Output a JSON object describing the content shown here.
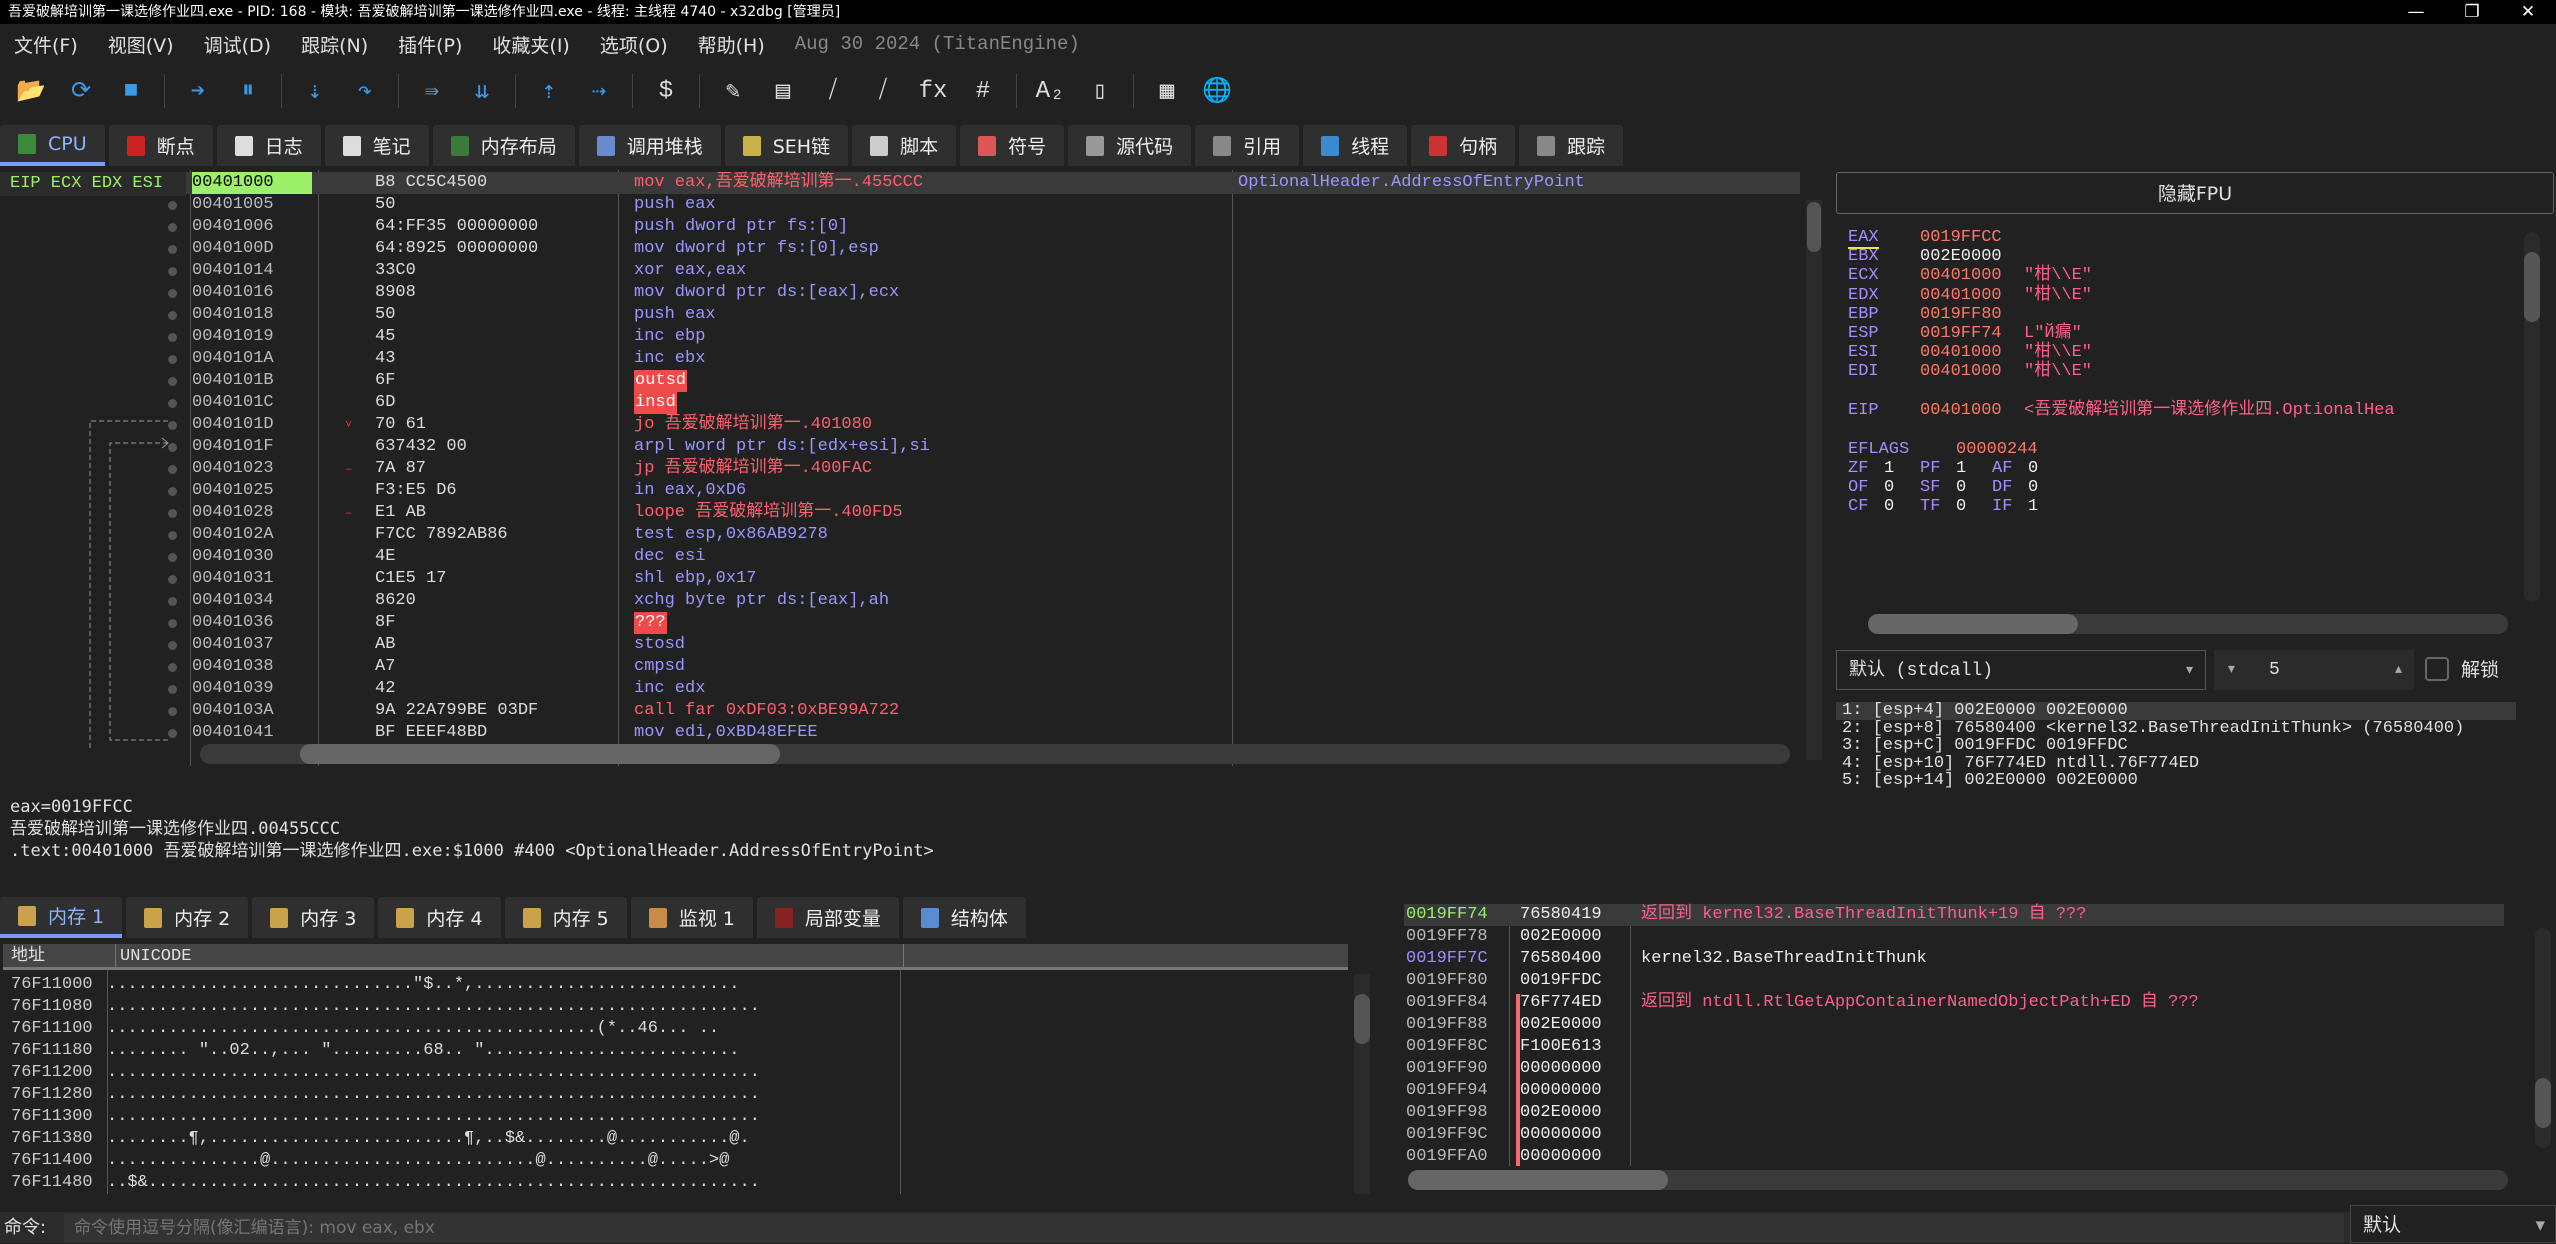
{
  "window": {
    "title": "吾爱破解培训第一课选修作业四.exe - PID: 168 - 模块: 吾爱破解培训第一课选修作业四.exe - 线程: 主线程 4740 - x32dbg [管理员]",
    "controls": [
      "—",
      "❐",
      "✕"
    ]
  },
  "menu": {
    "items": [
      "文件(F)",
      "视图(V)",
      "调试(D)",
      "跟踪(N)",
      "插件(P)",
      "收藏夹(I)",
      "选项(O)",
      "帮助(H)"
    ],
    "version": "Aug 30 2024 (TitanEngine)"
  },
  "toolbar": [
    {
      "icon": "open-folder-icon",
      "g": "📂"
    },
    {
      "icon": "restart-icon",
      "g": "⟳"
    },
    {
      "icon": "stop-icon",
      "g": "■"
    },
    {
      "sep": true
    },
    {
      "icon": "run-icon",
      "g": "➔"
    },
    {
      "icon": "pause-icon",
      "g": "⏸"
    },
    {
      "sep": true
    },
    {
      "icon": "step-into-icon",
      "g": "⇣"
    },
    {
      "icon": "step-over-icon",
      "g": "↷"
    },
    {
      "sep": true
    },
    {
      "icon": "trace-into-icon",
      "g": "⇛"
    },
    {
      "icon": "trace-over-icon",
      "g": "⇊"
    },
    {
      "sep": true
    },
    {
      "icon": "execute-till-return-icon",
      "g": "⇡"
    },
    {
      "icon": "run-to-user-code-icon",
      "g": "⇢"
    },
    {
      "sep": true
    },
    {
      "icon": "script-icon",
      "g": "$"
    },
    {
      "sep": true
    },
    {
      "icon": "patch-icon",
      "g": "✎"
    },
    {
      "icon": "comments-icon",
      "g": "▤"
    },
    {
      "icon": "labels-icon",
      "g": "⧸"
    },
    {
      "icon": "bookmarks-icon",
      "g": "⧸"
    },
    {
      "icon": "functions-icon",
      "g": "fx"
    },
    {
      "icon": "hash-icon",
      "g": "#"
    },
    {
      "sep": true
    },
    {
      "icon": "font-icon",
      "g": "A₂"
    },
    {
      "icon": "device-icon",
      "g": "▯"
    },
    {
      "sep": true
    },
    {
      "icon": "calculator-icon",
      "g": "▦"
    },
    {
      "icon": "globe-icon",
      "g": "🌐"
    }
  ],
  "tabs": [
    {
      "label": "CPU",
      "color": "#3c8a3c",
      "active": true
    },
    {
      "label": "断点",
      "color": "#c22"
    },
    {
      "label": "日志",
      "color": "#ddd"
    },
    {
      "label": "笔记",
      "color": "#ddd"
    },
    {
      "label": "内存布局",
      "color": "#3a7a3a"
    },
    {
      "label": "调用堆栈",
      "color": "#6a8ad0"
    },
    {
      "label": "SEH链",
      "color": "#c9b24a"
    },
    {
      "label": "脚本",
      "color": "#ccc"
    },
    {
      "label": "符号",
      "color": "#d55"
    },
    {
      "label": "源代码",
      "color": "#999"
    },
    {
      "label": "引用",
      "color": "#888"
    },
    {
      "label": "线程",
      "color": "#3a8ad0"
    },
    {
      "label": "句柄",
      "color": "#c33"
    },
    {
      "label": "跟踪",
      "color": "#888"
    }
  ],
  "disasm": {
    "reg_labels": "EIP ECX EDX ESI",
    "rows": [
      {
        "addr": "00401000",
        "bytes": "B8 CC5C4500",
        "ins": "mov eax,吾爱破解培训第一.455CCC",
        "kind": "jmp",
        "cmt": "OptionalHeader.AddressOfEntryPoint",
        "sel": true
      },
      {
        "addr": "00401005",
        "bytes": "50",
        "ins": "push eax"
      },
      {
        "addr": "00401006",
        "bytes": "64:FF35 00000000",
        "ins": "push dword ptr fs:[0]"
      },
      {
        "addr": "0040100D",
        "bytes": "64:8925 00000000",
        "ins": "mov dword ptr fs:[0],esp"
      },
      {
        "addr": "00401014",
        "bytes": "33C0",
        "ins": "xor eax,eax"
      },
      {
        "addr": "00401016",
        "bytes": "8908",
        "ins": "mov dword ptr ds:[eax],ecx"
      },
      {
        "addr": "00401018",
        "bytes": "50",
        "ins": "push eax"
      },
      {
        "addr": "00401019",
        "bytes": "45",
        "ins": "inc ebp"
      },
      {
        "addr": "0040101A",
        "bytes": "43",
        "ins": "inc ebx"
      },
      {
        "addr": "0040101B",
        "bytes": "6F",
        "ins": "outsd",
        "kind": "bad"
      },
      {
        "addr": "0040101C",
        "bytes": "6D",
        "ins": "insd",
        "kind": "bad"
      },
      {
        "addr": "0040101D",
        "bytes": "70 61",
        "ins": "jo 吾爱破解培训第一.401080",
        "kind": "jmp",
        "mark": "˅"
      },
      {
        "addr": "0040101F",
        "bytes": "637432 00",
        "ins": "arpl word ptr ds:[edx+esi],si"
      },
      {
        "addr": "00401023",
        "bytes": "7A 87",
        "ins": "jp 吾爱破解培训第一.400FAC",
        "kind": "jmp",
        "mark": "–"
      },
      {
        "addr": "00401025",
        "bytes": "F3:E5 D6",
        "ins": "in eax,0xD6"
      },
      {
        "addr": "00401028",
        "bytes": "E1 AB",
        "ins": "loope 吾爱破解培训第一.400FD5",
        "kind": "jmp",
        "mark": "–"
      },
      {
        "addr": "0040102A",
        "bytes": "F7CC 7892AB86",
        "ins": "test esp,0x86AB9278"
      },
      {
        "addr": "00401030",
        "bytes": "4E",
        "ins": "dec esi"
      },
      {
        "addr": "00401031",
        "bytes": "C1E5 17",
        "ins": "shl ebp,0x17"
      },
      {
        "addr": "00401034",
        "bytes": "8620",
        "ins": "xchg byte ptr ds:[eax],ah"
      },
      {
        "addr": "00401036",
        "bytes": "8F",
        "ins": "???",
        "kind": "bad"
      },
      {
        "addr": "00401037",
        "bytes": "AB",
        "ins": "stosd"
      },
      {
        "addr": "00401038",
        "bytes": "A7",
        "ins": "cmpsd"
      },
      {
        "addr": "00401039",
        "bytes": "42",
        "ins": "inc edx"
      },
      {
        "addr": "0040103A",
        "bytes": "9A 22A799BE 03DF",
        "ins": "call far 0xDF03:0xBE99A722",
        "kind": "jmp"
      },
      {
        "addr": "00401041",
        "bytes": "BF EEEF48BD",
        "ins": "mov edi,0xBD48EFEE"
      }
    ]
  },
  "info": {
    "lines": [
      "eax=0019FFCC",
      "吾爱破解培训第一课选修作业四.00455CCC",
      "",
      ".text:00401000 吾爱破解培训第一课选修作业四.exe:$1000 #400 <OptionalHeader.AddressOfEntryPoint>"
    ]
  },
  "registers": {
    "hide_fpu": "隐藏FPU",
    "gp": [
      {
        "name": "EAX",
        "value": "0019FFCC",
        "cmt": ""
      },
      {
        "name": "EBX",
        "value": "002E0000",
        "cmt": "",
        "white": true
      },
      {
        "name": "ECX",
        "value": "00401000",
        "cmt": "\"柑\\\\E\""
      },
      {
        "name": "EDX",
        "value": "00401000",
        "cmt": "\"柑\\\\E\""
      },
      {
        "name": "EBP",
        "value": "0019FF80",
        "cmt": ""
      },
      {
        "name": "ESP",
        "value": "0019FF74",
        "cmt": "L\"Й瘺\""
      },
      {
        "name": "ESI",
        "value": "00401000",
        "cmt": "\"柑\\\\E\""
      },
      {
        "name": "EDI",
        "value": "00401000",
        "cmt": "\"柑\\\\E\""
      }
    ],
    "eip": {
      "name": "EIP",
      "value": "00401000",
      "cmt": "<吾爱破解培训第一课选修作业四.OptionalHea"
    },
    "eflags": {
      "name": "EFLAGS",
      "value": "00000244"
    },
    "flags": [
      [
        "ZF",
        "1"
      ],
      [
        "PF",
        "1"
      ],
      [
        "AF",
        "0"
      ],
      [
        "OF",
        "0"
      ],
      [
        "SF",
        "0"
      ],
      [
        "DF",
        "0"
      ],
      [
        "CF",
        "0"
      ],
      [
        "TF",
        "0"
      ],
      [
        "IF",
        "1"
      ]
    ]
  },
  "callstack_args": {
    "convention": "默认 (stdcall)",
    "count": "5",
    "unlock_label": "解锁",
    "unlocked": false,
    "rows": [
      "1: [esp+4] 002E0000 002E0000",
      "2: [esp+8] 76580400 <kernel32.BaseThreadInitThunk> (76580400)",
      "3: [esp+C] 0019FFDC 0019FFDC",
      "4: [esp+10] 76F774ED ntdll.76F774ED",
      "5: [esp+14] 002E0000 002E0000"
    ]
  },
  "bottom_tabs": [
    {
      "label": "内存 1",
      "active": true,
      "color": "#c9a24a"
    },
    {
      "label": "内存 2",
      "color": "#c9a24a"
    },
    {
      "label": "内存 3",
      "color": "#c9a24a"
    },
    {
      "label": "内存 4",
      "color": "#c9a24a"
    },
    {
      "label": "内存 5",
      "color": "#c9a24a"
    },
    {
      "label": "监视 1",
      "color": "#c98a4a"
    },
    {
      "label": "局部变量",
      "color": "#822"
    },
    {
      "label": "结构体",
      "color": "#5a8ad0"
    }
  ],
  "dump": {
    "headers": [
      "地址",
      "UNICODE"
    ],
    "rows": [
      {
        "addr": "76F11000",
        "text": "..............................\"$..*,.........................."
      },
      {
        "addr": "76F11080",
        "text": "................................................................"
      },
      {
        "addr": "76F11100",
        "text": "................................................(*..46... .."
      },
      {
        "addr": "76F11180",
        "text": "........ \"..02..,... \".........68.. \"........................."
      },
      {
        "addr": "76F11200",
        "text": "................................................................"
      },
      {
        "addr": "76F11280",
        "text": "................................................................"
      },
      {
        "addr": "76F11300",
        "text": "................................................................"
      },
      {
        "addr": "76F11380",
        "text": "........¶,.........................¶,..$&........@...........@."
      },
      {
        "addr": "76F11400",
        "text": "...............@..........................@..........@.....>@"
      },
      {
        "addr": "76F11480",
        "text": "..$&............................................................"
      }
    ]
  },
  "stack": {
    "rows": [
      {
        "addr": "0019FF74",
        "val": "76580419",
        "cmt": "返回到 kernel32.BaseThreadInitThunk+19 自 ???",
        "sel": true,
        "red": true
      },
      {
        "addr": "0019FF78",
        "val": "002E0000",
        "cmt": ""
      },
      {
        "addr": "0019FF7C",
        "val": "76580400",
        "cmt": "kernel32.BaseThreadInitThunk"
      },
      {
        "addr": "0019FF80",
        "val": "0019FFDC",
        "cmt": ""
      },
      {
        "addr": "0019FF84",
        "val": "76F774ED",
        "cmt": "返回到 ntdll.RtlGetAppContainerNamedObjectPath+ED 自 ???",
        "red": true
      },
      {
        "addr": "0019FF88",
        "val": "002E0000",
        "cmt": ""
      },
      {
        "addr": "0019FF8C",
        "val": "F100E613",
        "cmt": ""
      },
      {
        "addr": "0019FF90",
        "val": "00000000",
        "cmt": ""
      },
      {
        "addr": "0019FF94",
        "val": "00000000",
        "cmt": ""
      },
      {
        "addr": "0019FF98",
        "val": "002E0000",
        "cmt": ""
      },
      {
        "addr": "0019FF9C",
        "val": "00000000",
        "cmt": ""
      },
      {
        "addr": "0019FFA0",
        "val": "00000000",
        "cmt": ""
      }
    ]
  },
  "command": {
    "label": "命令:",
    "placeholder": "命令使用逗号分隔(像汇编语言): mov eax, ebx",
    "mode": "默认"
  }
}
